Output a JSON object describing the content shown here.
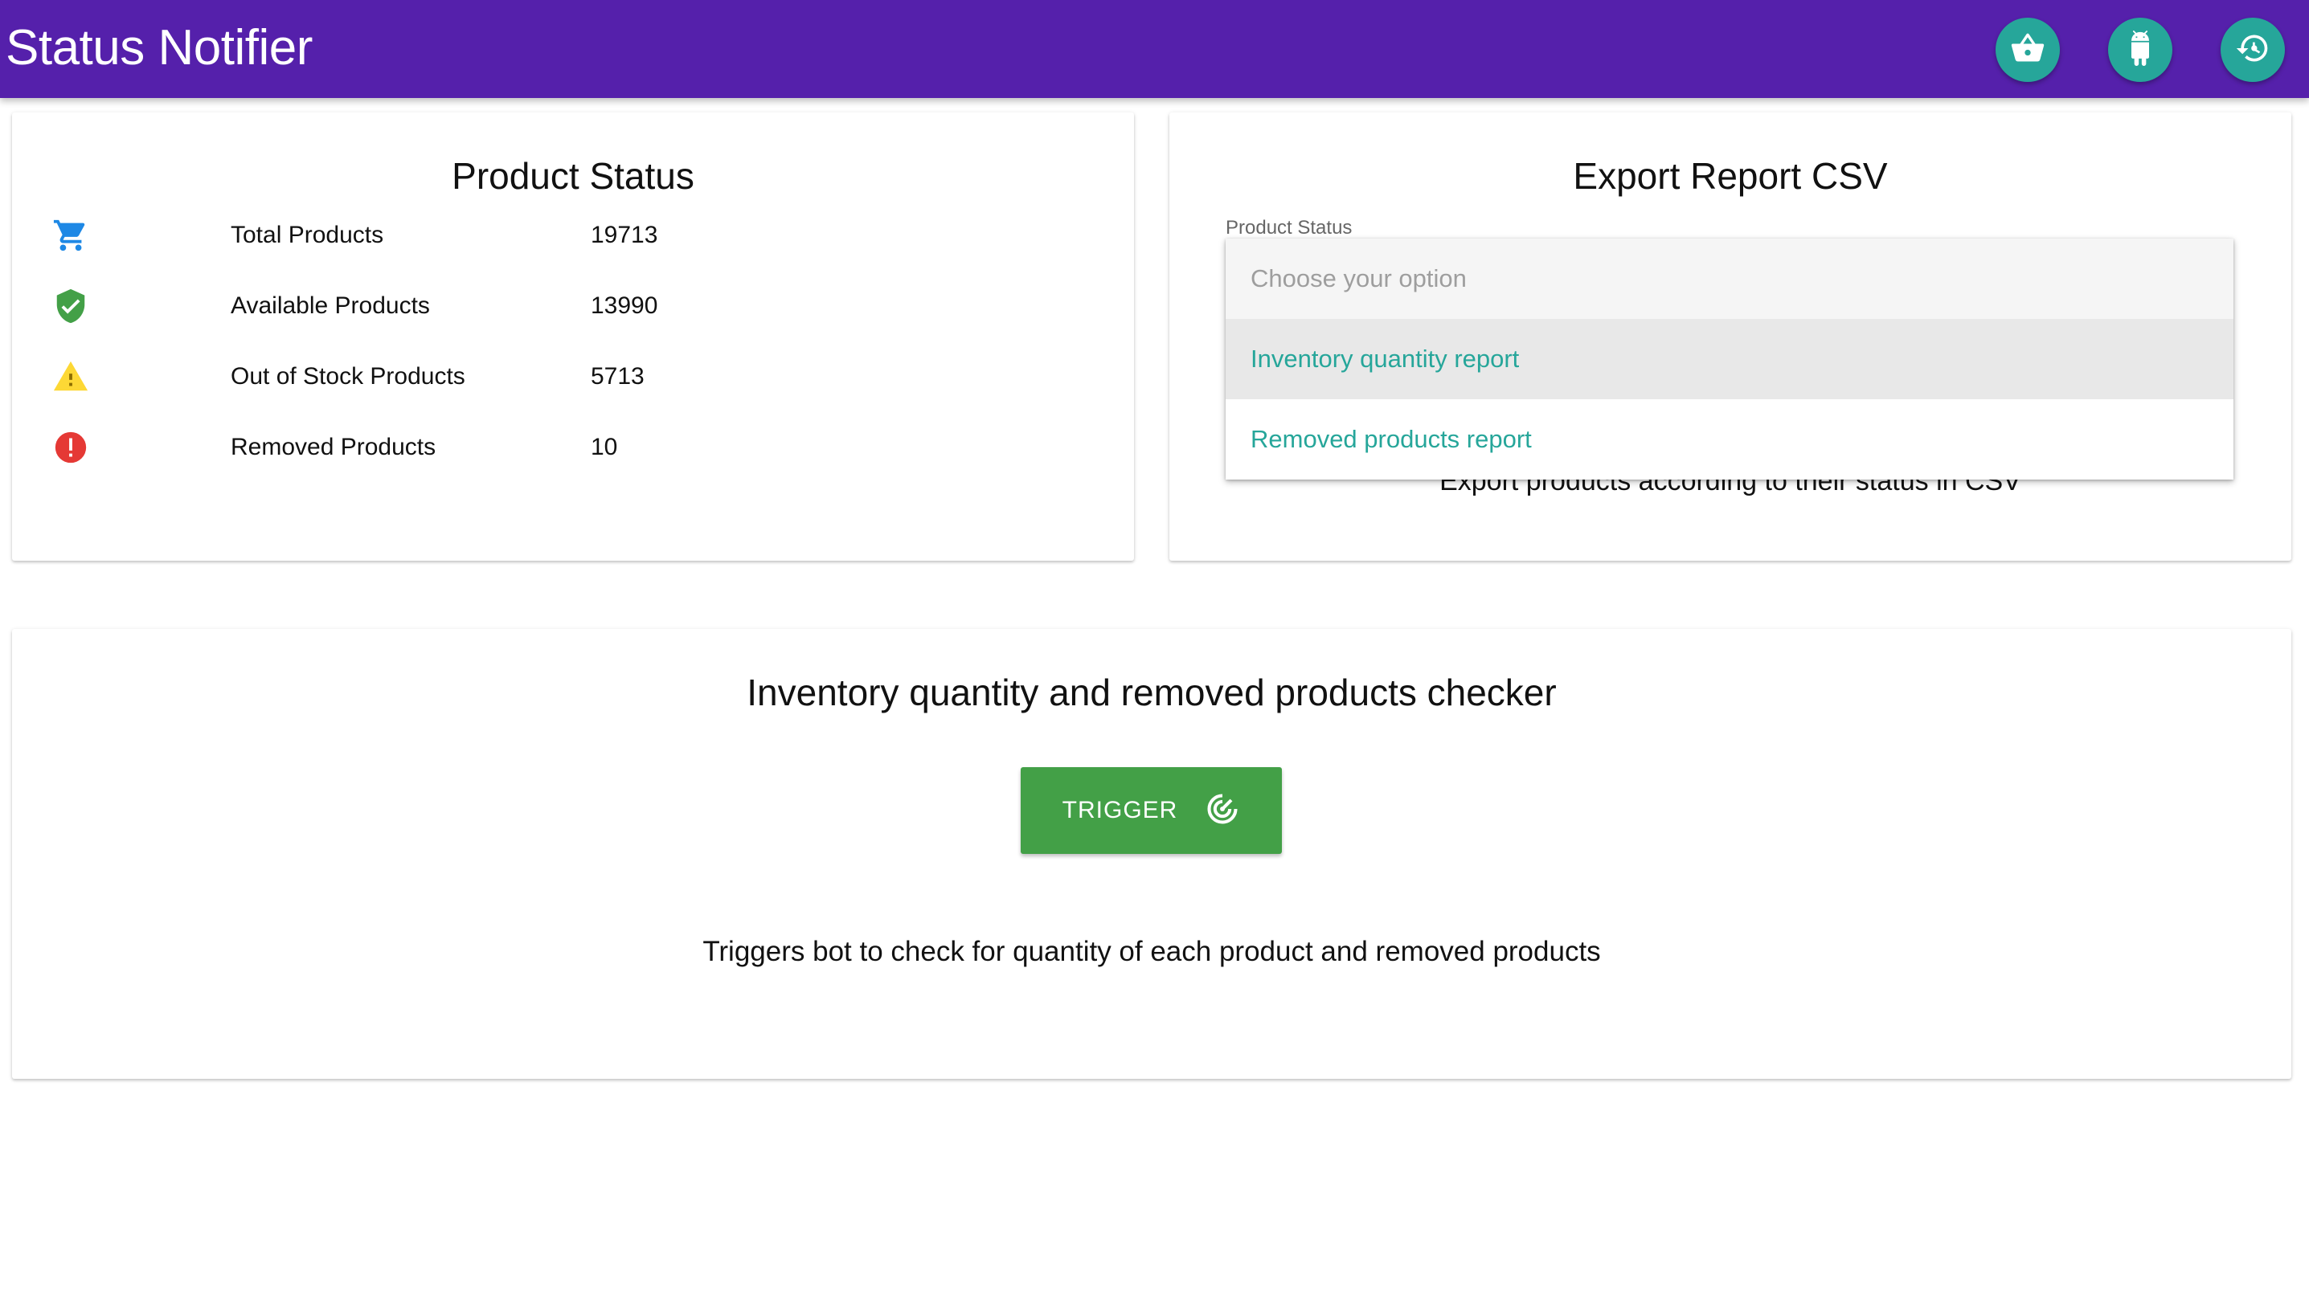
{
  "app": {
    "title": "Status Notifier"
  },
  "header": {
    "actions": [
      {
        "icon": "basket-icon",
        "label": ""
      },
      {
        "icon": "android-icon",
        "label": ""
      },
      {
        "icon": "history-icon",
        "label": ""
      }
    ]
  },
  "product_status": {
    "title": "Product Status",
    "rows": [
      {
        "icon": "cart-icon",
        "label": "Total Products",
        "value": "19713"
      },
      {
        "icon": "shield-check-icon",
        "label": "Available Products",
        "value": "13990"
      },
      {
        "icon": "warning-icon",
        "label": "Out of Stock Products",
        "value": "5713"
      },
      {
        "icon": "error-icon",
        "label": "Removed Products",
        "value": "10"
      }
    ]
  },
  "export": {
    "title": "Export Report CSV",
    "field_label": "Product Status",
    "placeholder": "Choose your option",
    "options": [
      "Inventory quantity report",
      "Removed products report"
    ],
    "description": "Export products according to their status in CSV"
  },
  "checker": {
    "title": "Inventory quantity and removed products checker",
    "button_label": "TRIGGER",
    "description": "Triggers bot to check for quantity of each product and removed products"
  },
  "colors": {
    "header": "#5520ab",
    "accent": "#26a69a",
    "button": "#43a047",
    "cart": "#1e88e5",
    "available": "#43a047",
    "warning": "#fdd835",
    "error": "#e53935"
  }
}
